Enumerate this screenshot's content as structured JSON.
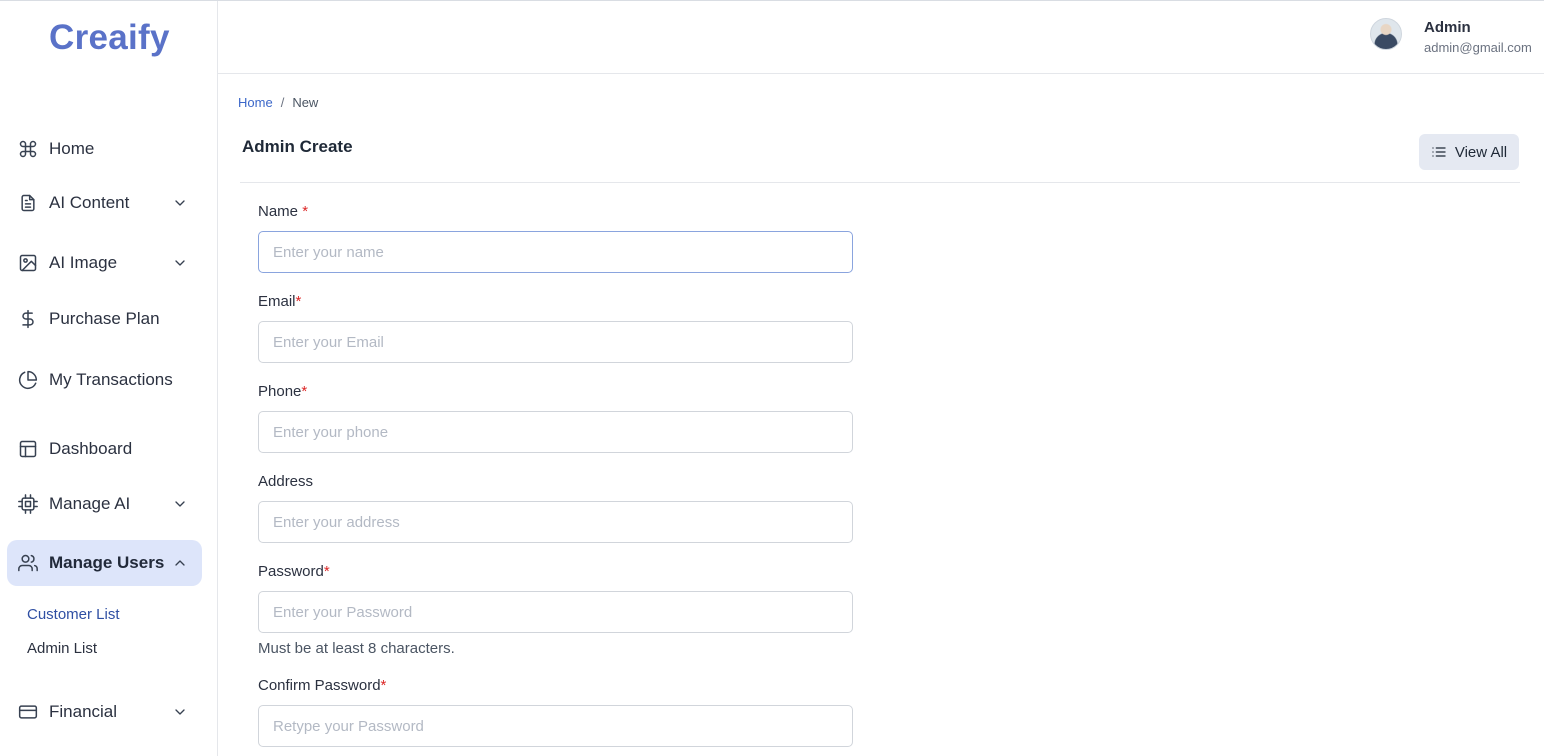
{
  "brand": {
    "name": "Creaify",
    "color": "#5a72c8"
  },
  "sidebar": {
    "items": [
      {
        "label": "Home",
        "icon": "command-icon"
      },
      {
        "label": "AI Content",
        "icon": "document-icon",
        "expandable": true
      },
      {
        "label": "AI Image",
        "icon": "image-icon",
        "expandable": true
      },
      {
        "label": "Purchase Plan",
        "icon": "dollar-icon"
      },
      {
        "label": "My Transactions",
        "icon": "pie-chart-icon"
      },
      {
        "label": "Dashboard",
        "icon": "layout-icon"
      },
      {
        "label": "Manage AI",
        "icon": "cpu-icon",
        "expandable": true
      },
      {
        "label": "Manage Users",
        "icon": "users-icon",
        "expandable": true,
        "expanded": true,
        "active": true
      },
      {
        "label": "Financial",
        "icon": "credit-card-icon",
        "expandable": true
      }
    ],
    "submenu": [
      {
        "label": "Customer List",
        "current": true
      },
      {
        "label": "Admin List"
      }
    ],
    "active_bg": "#dde5fa"
  },
  "header": {
    "user_name": "Admin",
    "user_email": "admin@gmail.com"
  },
  "breadcrumb": {
    "home": "Home",
    "separator": "/",
    "current": "New"
  },
  "page": {
    "title": "Admin Create",
    "view_all_label": "View All"
  },
  "form": {
    "name": {
      "label": "Name",
      "required_mark": "*",
      "placeholder": "Enter your name",
      "value": ""
    },
    "email": {
      "label": "Email",
      "required_mark": "*",
      "placeholder": "Enter your Email",
      "value": ""
    },
    "phone": {
      "label": "Phone",
      "required_mark": "*",
      "placeholder": "Enter your phone",
      "value": ""
    },
    "address": {
      "label": "Address",
      "placeholder": "Enter your address",
      "value": ""
    },
    "password": {
      "label": "Password",
      "required_mark": "*",
      "placeholder": "Enter your Password",
      "value": "",
      "help": "Must be at least 8 characters."
    },
    "confirm_password": {
      "label": "Confirm Password",
      "required_mark": "*",
      "placeholder": "Retype your Password",
      "value": ""
    }
  },
  "colors": {
    "required": "#dc2626",
    "link": "#3b67c9"
  }
}
